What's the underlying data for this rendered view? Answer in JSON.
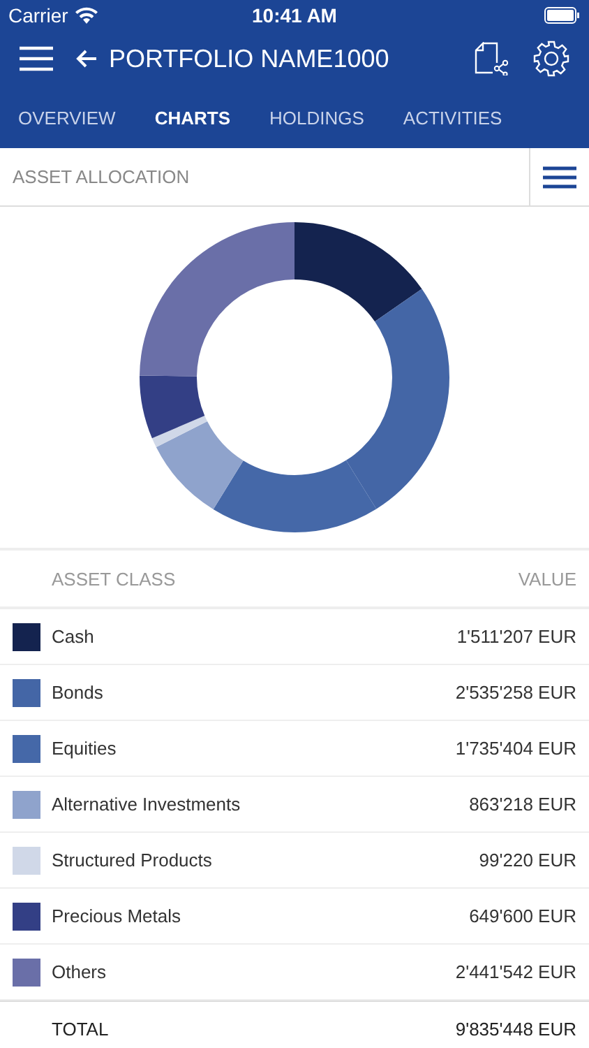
{
  "status_bar": {
    "carrier": "Carrier",
    "time": "10:41 AM"
  },
  "nav_bar": {
    "title": "PORTFOLIO NAME1000"
  },
  "tabs": [
    {
      "label": "OVERVIEW",
      "selected": false
    },
    {
      "label": "CHARTS",
      "selected": true
    },
    {
      "label": "HOLDINGS",
      "selected": false
    },
    {
      "label": "ACTIVITIES",
      "selected": false
    }
  ],
  "section": {
    "title": "ASSET ALLOCATION"
  },
  "chart_data": {
    "type": "donut",
    "categories": [
      "Cash",
      "Bonds",
      "Equities",
      "Alternative Investments",
      "Structured Products",
      "Precious Metals",
      "Others"
    ],
    "values": [
      15.36,
      25.78,
      17.64,
      8.78,
      1.01,
      6.6,
      24.83
    ]
  },
  "table": {
    "columns": [
      "ASSET CLASS",
      "VALUE"
    ],
    "rows": [
      {
        "value": "1'511'207 EUR",
        "color": "#14234f"
      },
      {
        "value": "2'535'258 EUR",
        "color": "#4466a6"
      },
      {
        "value": "1'735'404 EUR",
        "color": "#4568a8"
      },
      {
        "value": "863'218 EUR",
        "color": "#8fa3cc"
      },
      {
        "value": "99'220 EUR",
        "color": "#d0d8e8"
      },
      {
        "value": "649'600 EUR",
        "color": "#333f85"
      },
      {
        "value": "2'441'542 EUR",
        "color": "#6a6fa8"
      }
    ],
    "total": {
      "label": "TOTAL",
      "value": "9'835'448 EUR"
    }
  }
}
